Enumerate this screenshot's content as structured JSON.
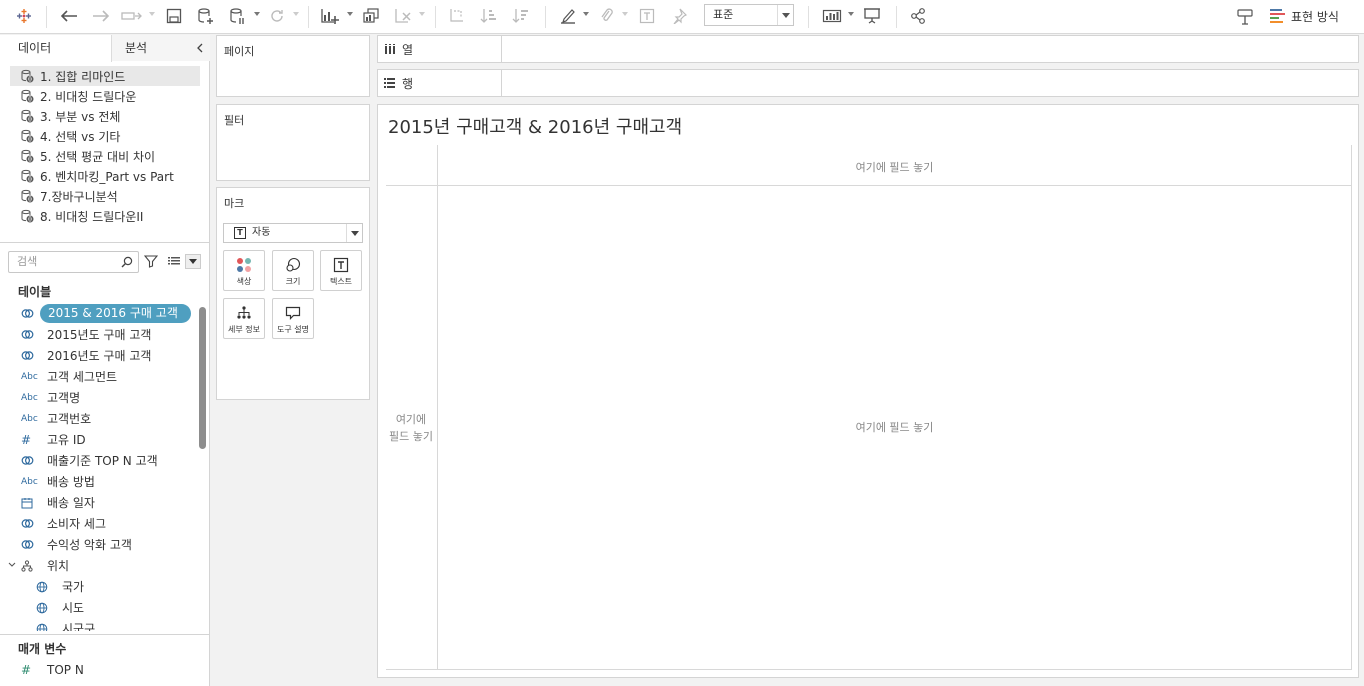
{
  "toolbar": {
    "fit_value": "표준",
    "show_me_label": "표현 방식",
    "show_me_colors": [
      "#4e79a7",
      "#e15759",
      "#59a14f",
      "#f28e2b"
    ]
  },
  "data_pane": {
    "tab_data": "데이터",
    "tab_analysis": "분석",
    "data_sources": [
      "1. 집합 리마인드",
      "2. 비대칭 드릴다운",
      "3. 부분 vs 전체",
      "4. 선택 vs 기타",
      "5. 선택 평균 대비 차이",
      "6. 벤치마킹_Part vs Part",
      "7.장바구니분석",
      "8. 비대칭 드릴다운II"
    ],
    "search_placeholder": "검색",
    "tables_header": "테이블",
    "fields": [
      {
        "label": "2015 & 2016 구매 고객",
        "icon": "set-icon"
      },
      {
        "label": "2015년도 구매 고객",
        "icon": "set-icon"
      },
      {
        "label": "2016년도 구매 고객",
        "icon": "set-icon"
      },
      {
        "label": "고객 세그먼트",
        "icon": "Abc"
      },
      {
        "label": "고객명",
        "icon": "Abc"
      },
      {
        "label": "고객번호",
        "icon": "Abc"
      },
      {
        "label": "고유 ID",
        "icon": "#"
      },
      {
        "label": "매출기준 TOP N 고객",
        "icon": "set-icon"
      },
      {
        "label": "배송 방법",
        "icon": "Abc"
      },
      {
        "label": "배송 일자",
        "icon": "calendar-icon"
      },
      {
        "label": "소비자 세그",
        "icon": "set-icon"
      },
      {
        "label": "수익성 악화 고객",
        "icon": "set-icon"
      },
      {
        "label": "위치",
        "icon": "hierarchy-icon"
      },
      {
        "label": "국가",
        "icon": "globe-icon"
      },
      {
        "label": "시도",
        "icon": "globe-icon"
      },
      {
        "label": "시군구",
        "icon": "globe-icon"
      }
    ],
    "parameters_header": "매개 변수",
    "parameters": [
      {
        "label": "TOP N",
        "icon": "#"
      }
    ]
  },
  "shelves": {
    "pages": "페이지",
    "filters": "필터",
    "marks": "마크",
    "mark_type": "자동",
    "mark_buttons": [
      "색상",
      "크기",
      "텍스트",
      "세부 정보",
      "도구 설명"
    ],
    "columns": "열",
    "rows": "행"
  },
  "view": {
    "title": "2015년 구매고객 & 2016년 구매고객",
    "drop_top": "여기에 필드 놓기",
    "drop_left_line1": "여기에",
    "drop_left_line2": "필드 놓기",
    "drop_center": "여기에 필드 놓기"
  }
}
